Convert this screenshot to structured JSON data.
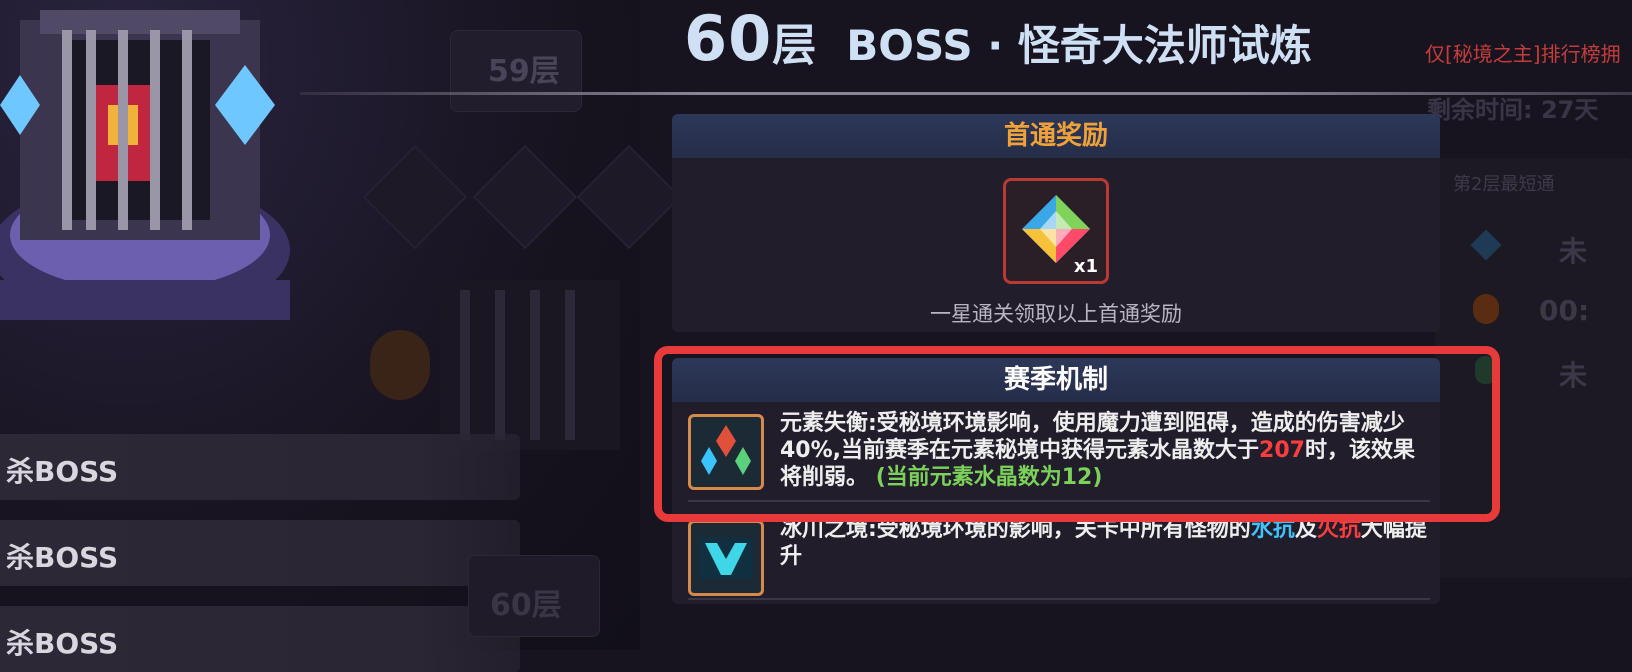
{
  "left_area": {
    "floor_label_top": "59层",
    "floor_label_bottom": "60层",
    "rows": [
      {
        "label": "杀BOSS"
      },
      {
        "label": "杀BOSS"
      },
      {
        "label": "杀BOSS"
      }
    ]
  },
  "header": {
    "floor_number": "60",
    "floor_unit": "层",
    "title": "BOSS · 怪奇大法师试炼",
    "rank_note": "仅[秘境之主]排行榜拥"
  },
  "right_side": {
    "remaining_time": "剩余时间: 27天",
    "fastest_label": "第2层最短通",
    "entries": [
      "未",
      "00:",
      "未"
    ]
  },
  "first_clear": {
    "header": "首通奖励",
    "reward_icon": "rainbow-crystal-icon",
    "reward_qty": "x1",
    "note": "一星通关领取以上首通奖励"
  },
  "season": {
    "header": "赛季机制",
    "mechanics": [
      {
        "icon": "element-crystals-icon",
        "text_1": "元素失衡:受秘境环境影响，使用魔力遭到阻碍，造成的伤害减少40%,当前赛季在元素秘境中获得元素水晶数大于",
        "threshold": "207",
        "text_2": "时，该效果将削弱。",
        "status": "(当前元素水晶数为12)"
      },
      {
        "icon": "glacier-icon",
        "text_1": "冰川之境:受秘境环境的影响，关卡中所有怪物的",
        "water": "水抗",
        "and": "及",
        "fire": "火抗",
        "text_2": "大幅提升"
      }
    ]
  },
  "colors": {
    "highlight_box": "#e8393b",
    "header_gold": "#f0a23a",
    "title_blue": "#cfe0f5",
    "threshold_red": "#ff3d3d",
    "status_green": "#7bd15a",
    "water_blue": "#3ec3ff"
  }
}
